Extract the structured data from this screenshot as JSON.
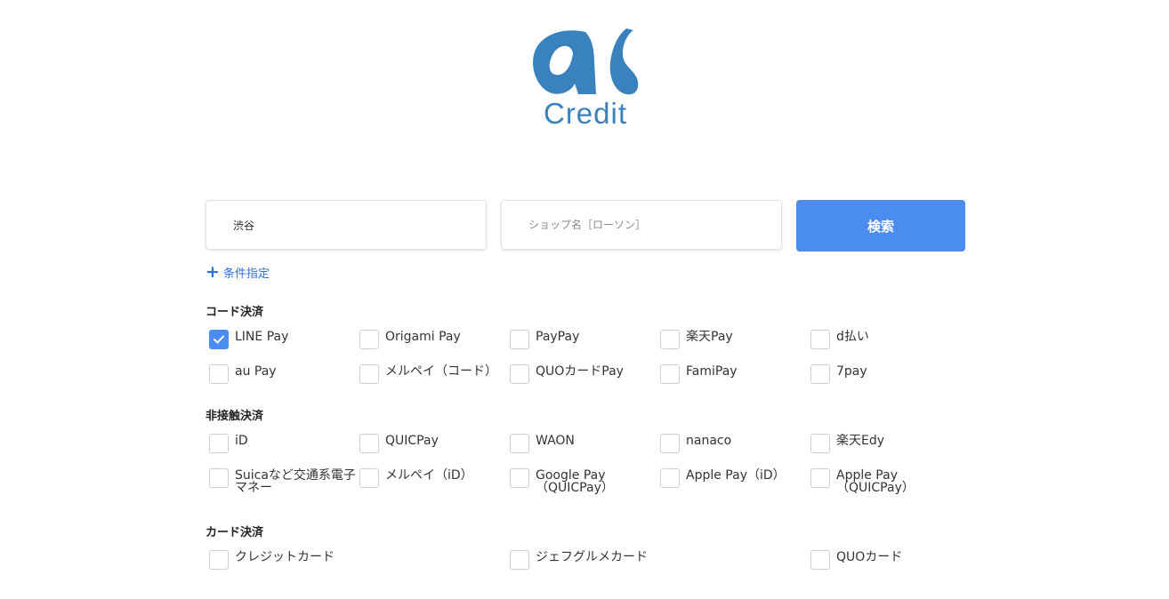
{
  "logo": {
    "text": "Credit",
    "brand_color": "#3a82bd"
  },
  "search": {
    "area_value": "渋谷",
    "shop_placeholder": "ショップ名［ローソン］",
    "button_label": "検索",
    "button_color": "#4a8cf0"
  },
  "conditions_link": "条件指定",
  "sections": {
    "code": {
      "title": "コード決済",
      "options": [
        {
          "label": "LINE Pay",
          "checked": true
        },
        {
          "label": "Origami Pay",
          "checked": false
        },
        {
          "label": "PayPay",
          "checked": false
        },
        {
          "label": "楽天Pay",
          "checked": false
        },
        {
          "label": "d払い",
          "checked": false
        },
        {
          "label": "au Pay",
          "checked": false
        },
        {
          "label": "メルペイ（コード）",
          "checked": false
        },
        {
          "label": "QUOカードPay",
          "checked": false
        },
        {
          "label": "FamiPay",
          "checked": false
        },
        {
          "label": "7pay",
          "checked": false
        }
      ]
    },
    "contactless": {
      "title": "非接触決済",
      "options": [
        {
          "label": "iD",
          "checked": false
        },
        {
          "label": "QUICPay",
          "checked": false
        },
        {
          "label": "WAON",
          "checked": false
        },
        {
          "label": "nanaco",
          "checked": false
        },
        {
          "label": "楽天Edy",
          "checked": false
        },
        {
          "label": "Suicaなど交通系電子マネー",
          "checked": false
        },
        {
          "label": "メルペイ（iD）",
          "checked": false
        },
        {
          "label": "Google Pay（QUICPay）",
          "checked": false
        },
        {
          "label": "Apple Pay（iD）",
          "checked": false
        },
        {
          "label": "Apple Pay（QUICPay）",
          "checked": false
        }
      ]
    },
    "card": {
      "title": "カード決済",
      "options": [
        {
          "label": "クレジットカード",
          "checked": false
        },
        {
          "label": "ジェフグルメカード",
          "checked": false
        },
        {
          "label": "QUOカード",
          "checked": false
        }
      ]
    }
  }
}
